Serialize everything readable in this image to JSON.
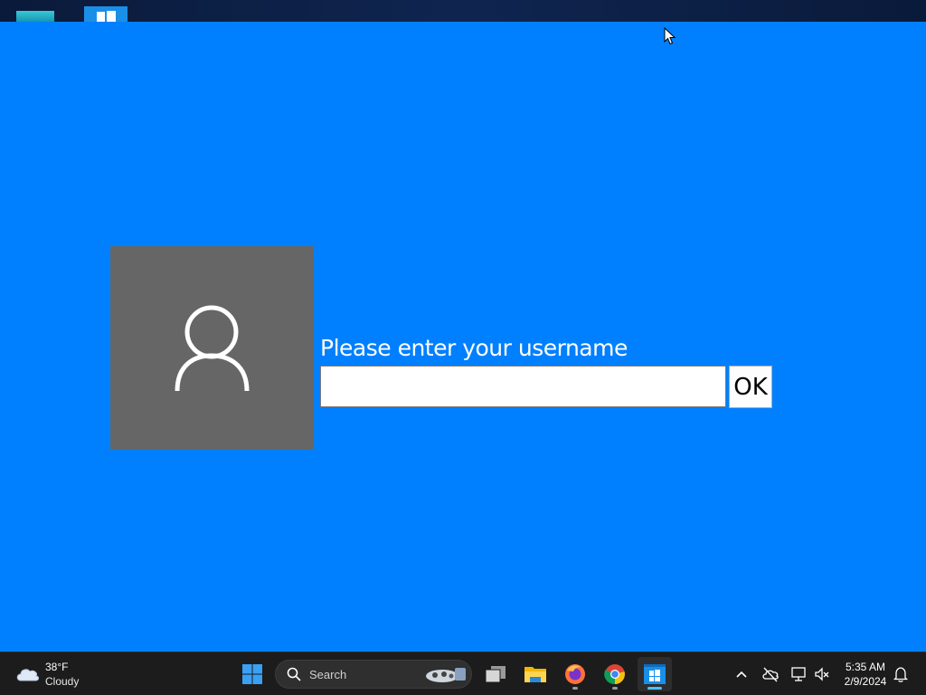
{
  "app": {
    "prompt_label": "Please enter your username",
    "username_value": "",
    "ok_label": "OK",
    "background_color": "#0080ff",
    "avatar_panel_color": "#666666"
  },
  "taskbar": {
    "weather": {
      "temperature": "38°F",
      "condition": "Cloudy",
      "icon": "cloud-icon"
    },
    "start_icon": "windows-start-icon",
    "search": {
      "label": "Search"
    },
    "pinned": [
      {
        "name": "task-view",
        "icon": "task-view-icon"
      },
      {
        "name": "file-explorer",
        "icon": "folder-icon"
      },
      {
        "name": "firefox",
        "icon": "firefox-icon"
      },
      {
        "name": "chrome",
        "icon": "chrome-icon"
      },
      {
        "name": "active-app",
        "icon": "app-window-icon"
      }
    ],
    "tray": {
      "icons": [
        "chevron-up-icon",
        "cloud-offline-icon",
        "network-icon",
        "speaker-muted-icon",
        "notification-bell-icon"
      ],
      "time": "5:35 AM",
      "date": "2/9/2024"
    }
  }
}
